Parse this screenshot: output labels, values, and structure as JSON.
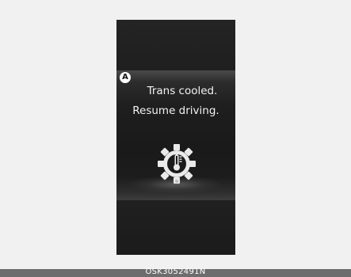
{
  "display": {
    "callout_label": "A",
    "message_line_1": "Trans cooled.",
    "message_line_2": "Resume driving.",
    "icon": "transmission-temperature-gear-icon",
    "colors": {
      "screen_background": "#1d1d1d",
      "text": "#f2f2f2",
      "page_background": "#f1f1f1"
    }
  },
  "footer": {
    "code": "OSK3052491N"
  }
}
